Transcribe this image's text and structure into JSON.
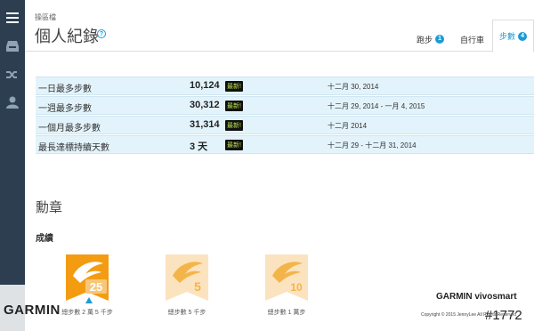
{
  "sidebar": {
    "items": [
      {
        "icon": "menu-icon"
      },
      {
        "icon": "inbox-icon"
      },
      {
        "icon": "shuffle-icon"
      },
      {
        "icon": "user-icon"
      }
    ],
    "bg_color": "#2c3e50"
  },
  "header": {
    "breadcrumb": "操區檔",
    "title": "個人紀錄",
    "help": "?",
    "tabs": [
      {
        "label": "跑步",
        "count": "1"
      },
      {
        "label": "自行車",
        "count": ""
      },
      {
        "label": "步數",
        "count": "4"
      }
    ],
    "accent_color": "#1a9bd7"
  },
  "records": [
    {
      "label": "一日最多步數",
      "value": "10,124",
      "new": "最新!",
      "date": "十二月 30, 2014"
    },
    {
      "label": "一週最多步數",
      "value": "30,312",
      "new": "最新!",
      "date": "十二月 29, 2014 - 一月 4, 2015"
    },
    {
      "label": "一個月最多步數",
      "value": "31,314",
      "new": "最新!",
      "date": "十二月 2014"
    },
    {
      "label": "最長達標持續天數",
      "value": "3 天",
      "new": "最新!",
      "date": "十二月 29 - 十二月 31, 2014"
    }
  ],
  "badges_section": {
    "title": "勳章",
    "subtitle": "成績",
    "badges": [
      {
        "number": "25",
        "caption": "總步數 2 萬 5 千步"
      },
      {
        "number": "5",
        "caption": "總步數 5 千步"
      },
      {
        "number": "10",
        "caption": "總步數 1 萬步"
      }
    ]
  },
  "watermark": {
    "left": "GARMIN",
    "right_title": "GARMIN vivosmart",
    "right_num": "#1772",
    "copyright": "Copyright © 2015 JennyLee All Rights Reserved"
  }
}
